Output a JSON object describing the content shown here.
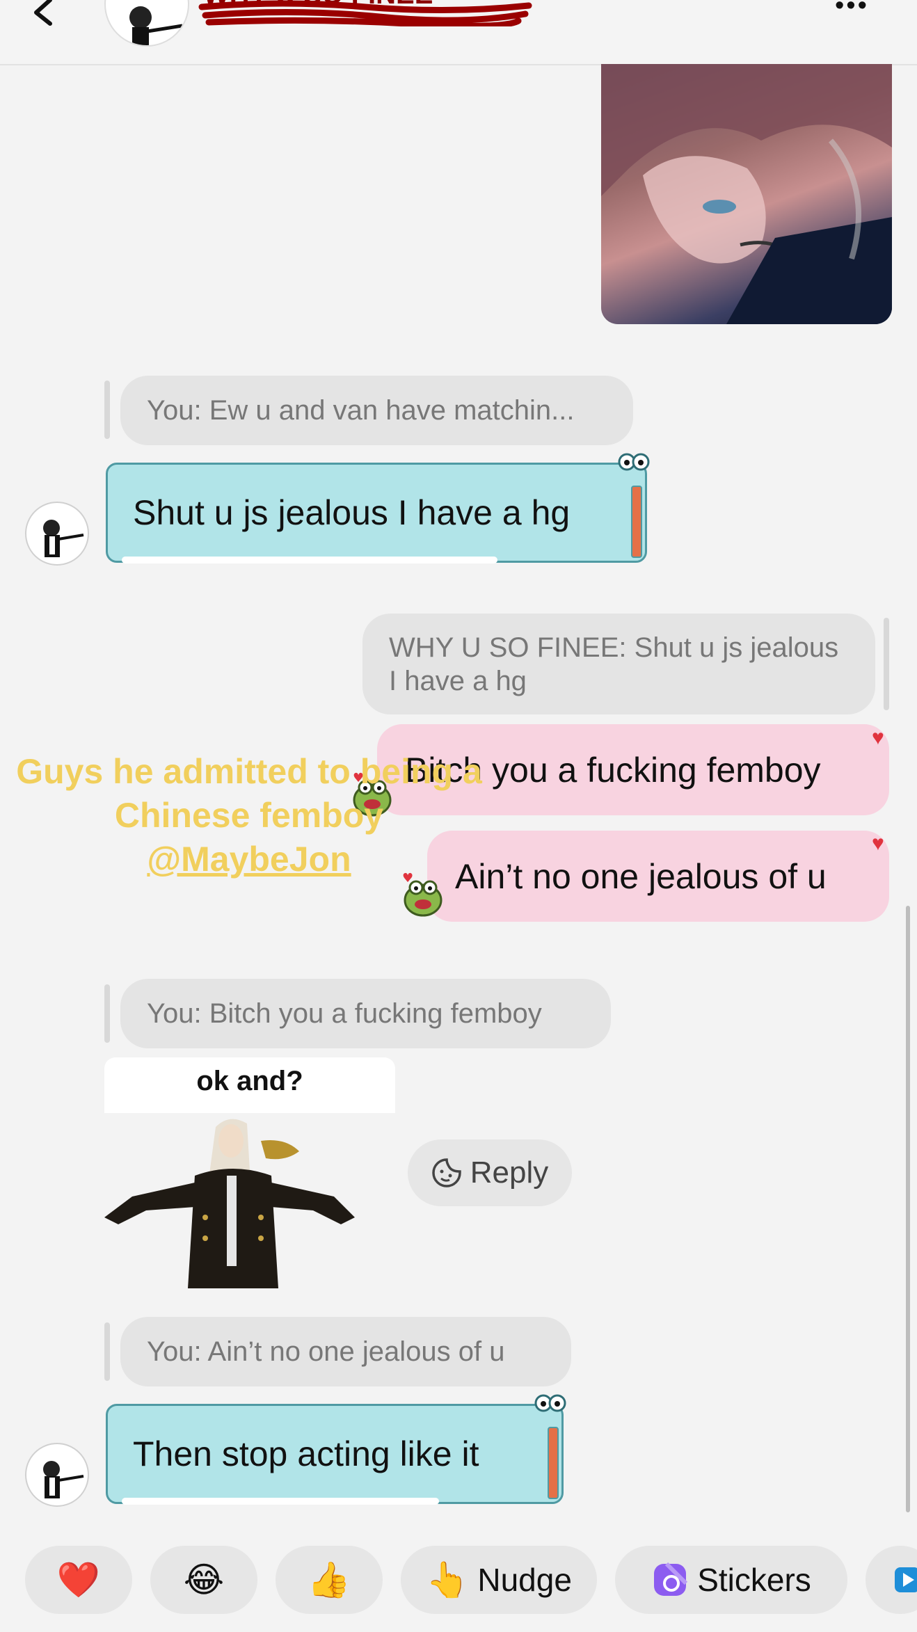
{
  "header": {
    "contact_name": "WHY U SO FINEE",
    "back_icon": "chevron-left-icon",
    "more_icon": "more-dots-icon"
  },
  "messages": {
    "quote1": "You: Ew u and van have matchin...",
    "bubble1": "Shut u js jealous I have a hg",
    "quote2": "WHY U SO FINEE: Shut u js jealous I have a hg",
    "bubble2": "Bitch you a fucking femboy",
    "bubble3": "Ain’t no one jealous of u",
    "quote3": "You: Bitch you a fucking femboy",
    "sticker_caption": "ok and?",
    "reply_label": "Reply",
    "quote4": "You: Ain’t no one jealous of u",
    "bubble4": "Then stop acting like it"
  },
  "overlay": {
    "line1": "Guys he admitted to being a",
    "line2": "Chinese femboy",
    "mention": "@MaybeJon"
  },
  "quick_reactions": {
    "heart": "❤️",
    "laugh": "😂",
    "thumbs": "👍",
    "nudge_emoji": "👆",
    "nudge": "Nudge",
    "stickers": "Stickers"
  },
  "colors": {
    "incoming_bubble": "#b1e4e8",
    "outgoing_bubble": "#f8d3e0",
    "overlay_text": "#f1cf5d",
    "heart": "#e0333e"
  }
}
